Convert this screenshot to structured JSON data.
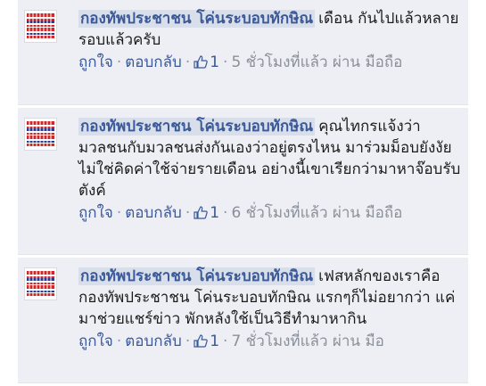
{
  "comments": [
    {
      "author": "กองทัพประชาชน โค่นระบอบทักษิณ",
      "text": "เดือน กันไปแล้วหลายรอบแล้วครับ",
      "like_label": "ถูกใจ",
      "reply_label": "ตอบกลับ",
      "like_count": "1",
      "time_via": "5 ชั่วโมงที่แล้ว ผ่าน มือถือ"
    },
    {
      "author": "กองทัพประชาชน โค่นระบอบทักษิณ",
      "text": "คุณไทกรแจ้งว่ามวลชนกับมวลชนส่งกันเองว่าอยู่ตรงไหน มาร่วมม็อบยังงัย ไม่ใช่คิดค่าใช้จ่ายรายเดือน อย่างนี้เขาเรียกว่ามาหาจ๊อบรับตังค์",
      "like_label": "ถูกใจ",
      "reply_label": "ตอบกลับ",
      "like_count": "1",
      "time_via": "6 ชั่วโมงที่แล้ว ผ่าน มือถือ"
    },
    {
      "author": "กองทัพประชาชน โค่นระบอบทักษิณ",
      "text": "เฟสหลักของเราคือ กองทัพประชาชน โค่นระบอบทักษิณ แรกๆก็ไม่อยากว่า แค่มาช่วยแชร์ข่าว พักหลังใช้เป็นวิธีทำมาหากิน",
      "like_label": "ถูกใจ",
      "reply_label": "ตอบกลับ",
      "like_count": "1",
      "time_via": "7 ชั่วโมงที่แล้ว ผ่าน มือ"
    }
  ],
  "colors": {
    "link": "#3b5998",
    "background": "#edeff4",
    "author_highlight": "#d8dfea"
  },
  "icons": {
    "like": "thumbs-up-icon",
    "avatar": "avatar-stripes-image"
  }
}
